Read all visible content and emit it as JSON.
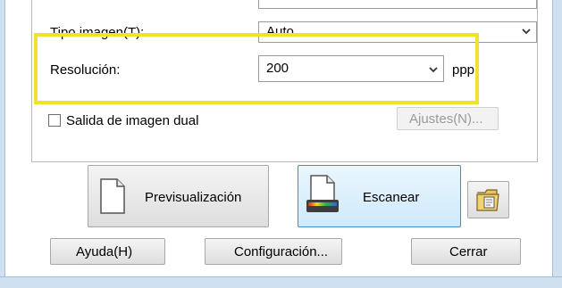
{
  "form": {
    "tipo_imagen_label": "Tipo imagen(T):",
    "tipo_imagen_value": "Auto",
    "resolucion_label": "Resolución:",
    "resolucion_value": "200",
    "resolucion_unit": "ppp",
    "dual_checkbox_label": "Salida de imagen dual",
    "dual_checked": false,
    "ajustes_button": "Ajustes(N)..."
  },
  "actions": {
    "preview_label": "Previsualización",
    "scan_label": "Escanear"
  },
  "footer": {
    "help_label": "Ayuda(H)",
    "config_label": "Configuración...",
    "close_label": "Cerrar"
  },
  "colors": {
    "highlight": "#f2e22d",
    "window_frame": "#cfe0f1",
    "selected_button_border": "#3c8fd0"
  },
  "icons": {
    "preview": "document-icon",
    "scan": "scanner-icon",
    "folder": "folder-icon",
    "combo_arrow": "chevron-down-icon"
  }
}
